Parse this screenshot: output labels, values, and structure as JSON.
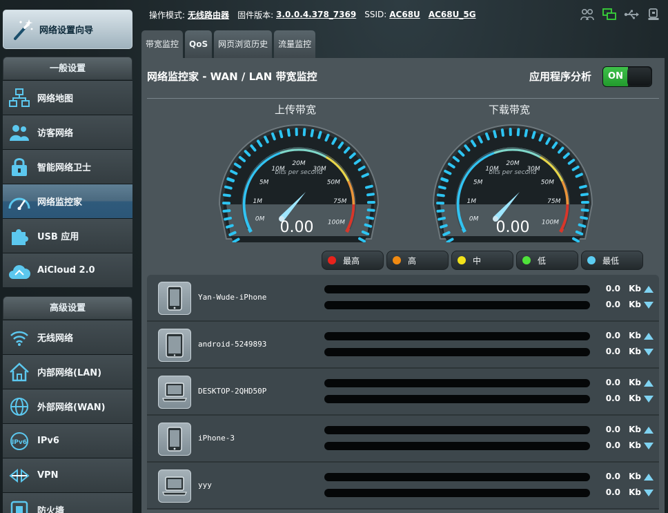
{
  "sidebar": {
    "wizard_label": "网络设置向导",
    "general_header": "一般设置",
    "general_items": [
      {
        "label": "网络地图",
        "icon": "network-map-icon"
      },
      {
        "label": "访客网络",
        "icon": "guest-network-icon"
      },
      {
        "label": "智能网络卫士",
        "icon": "aiprotection-icon"
      },
      {
        "label": "网络监控家",
        "icon": "traffic-monitor-icon",
        "active": true
      },
      {
        "label": "USB 应用",
        "icon": "usb-app-icon"
      },
      {
        "label": "AiCloud 2.0",
        "icon": "aicloud-icon"
      }
    ],
    "advanced_header": "高级设置",
    "advanced_items": [
      {
        "label": "无线网络",
        "icon": "wireless-icon"
      },
      {
        "label": "内部网络(LAN)",
        "icon": "lan-icon"
      },
      {
        "label": "外部网络(WAN)",
        "icon": "wan-icon"
      },
      {
        "label": "IPv6",
        "icon": "ipv6-icon"
      },
      {
        "label": "VPN",
        "icon": "vpn-icon"
      },
      {
        "label": "防火墙",
        "icon": "firewall-icon"
      }
    ]
  },
  "status": {
    "mode_label": "操作模式:",
    "mode_value": "无线路由器",
    "firmware_label": "固件版本:",
    "firmware_value": "3.0.0.4.378_7369",
    "ssid_label": "SSID:",
    "ssid_1": "AC68U",
    "ssid_2": "AC68U_5G"
  },
  "tabs": [
    "带宽监控",
    "QoS",
    "网页浏览历史",
    "流量监控"
  ],
  "panel": {
    "title": "网络监控家 - WAN / LAN 带宽监控",
    "app_analysis_label": "应用程序分析",
    "toggle_state": "ON",
    "upload_label": "上传带宽",
    "download_label": "下载带宽",
    "upload_value": "0.00",
    "download_value": "0.00",
    "gauge_unit_text": "bits per second",
    "gauge_ticks": [
      "0M",
      "1M",
      "5M",
      "10M",
      "20M",
      "30M",
      "50M",
      "75M",
      "100M"
    ]
  },
  "legend": [
    {
      "label": "最高",
      "color": "#e8231c"
    },
    {
      "label": "高",
      "color": "#f08a12"
    },
    {
      "label": "中",
      "color": "#f2e21a"
    },
    {
      "label": "低",
      "color": "#4fe23a"
    },
    {
      "label": "最低",
      "color": "#5ccdf2"
    }
  ],
  "devices": [
    {
      "name": "Yan-Wude-iPhone",
      "type": "phone",
      "up": "0.0",
      "down": "0.0",
      "unit": "Kb"
    },
    {
      "name": "android-5249893",
      "type": "tablet",
      "up": "0.0",
      "down": "0.0",
      "unit": "Kb"
    },
    {
      "name": "DESKTOP-2QHD50P",
      "type": "laptop",
      "up": "0.0",
      "down": "0.0",
      "unit": "Kb"
    },
    {
      "name": "iPhone-3",
      "type": "phone",
      "up": "0.0",
      "down": "0.0",
      "unit": "Kb"
    },
    {
      "name": "yyy",
      "type": "laptop",
      "up": "0.0",
      "down": "0.0",
      "unit": "Kb"
    }
  ]
}
